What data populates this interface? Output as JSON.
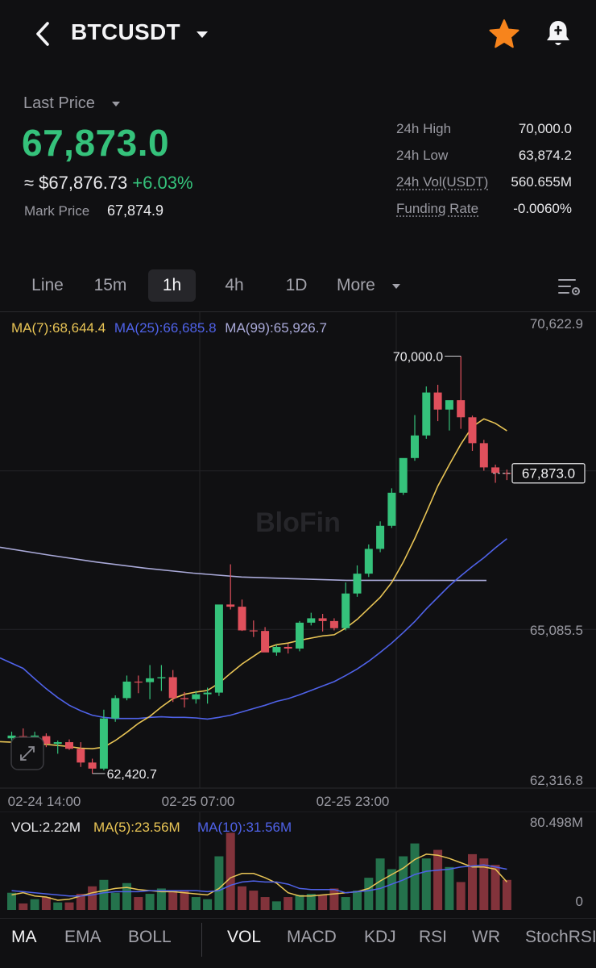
{
  "header": {
    "symbol": "BTCUSDT",
    "icons": {
      "back": "chevron-left-icon",
      "dropdown": "caret-down-icon",
      "favorite": "star-icon",
      "alert": "bell-icon"
    },
    "favorite_color": "#f7841c"
  },
  "price": {
    "last_price_label": "Last Price",
    "last_price": "67,873.0",
    "usd_equiv": "≈ $67,876.73",
    "change_pct": "+6.03%",
    "mark_label": "Mark Price",
    "mark_value": "67,874.9",
    "stats": [
      {
        "label": "24h High",
        "value": "70,000.0"
      },
      {
        "label": "24h Low",
        "value": "63,874.2"
      },
      {
        "label": "24h Vol(USDT)",
        "value": "560.655M"
      },
      {
        "label": "Funding Rate",
        "value": "-0.0060%"
      }
    ],
    "up_color": "#35c27b",
    "down_color": "#e0505c"
  },
  "timeframes": {
    "tabs": [
      "Line",
      "15m",
      "1h",
      "4h",
      "1D",
      "More"
    ],
    "active": "1h"
  },
  "chart_data": {
    "type": "candlestick",
    "watermark": "BloFin",
    "legend": {
      "ma7": "MA(7):68,644.4",
      "ma25": "MA(25):66,685.8",
      "ma99": "MA(99):65,926.7"
    },
    "y_ticks": [
      "70,622.9",
      "65,085.5",
      "62,316.8"
    ],
    "x_ticks": [
      "02-24 14:00",
      "02-25 07:00",
      "02-25 23:00"
    ],
    "high_marker": "70,000.0",
    "low_marker": "62,420.7",
    "current_price_tag": "67,873.0",
    "ylim": [
      62316.8,
      70622.9
    ],
    "candles": [
      [
        63060,
        63180,
        62900,
        63110
      ],
      [
        63100,
        63240,
        62980,
        62990
      ],
      [
        62980,
        63180,
        62820,
        63110
      ],
      [
        63100,
        63150,
        62900,
        62960
      ],
      [
        62960,
        63020,
        62780,
        62990
      ],
      [
        62990,
        63040,
        62850,
        62870
      ],
      [
        62870,
        62990,
        62540,
        62620
      ],
      [
        62620,
        62690,
        62420.7,
        62510
      ],
      [
        62510,
        63580,
        62480,
        63420
      ],
      [
        63420,
        63840,
        63360,
        63790
      ],
      [
        63790,
        64200,
        63750,
        64090
      ],
      [
        64090,
        64200,
        63880,
        64080
      ],
      [
        64080,
        64390,
        63770,
        64150
      ],
      [
        64150,
        64390,
        63920,
        64170
      ],
      [
        64170,
        64300,
        63720,
        63790
      ],
      [
        63790,
        63900,
        63620,
        63770
      ],
      [
        63770,
        63920,
        63690,
        63860
      ],
      [
        63860,
        63980,
        63690,
        63890
      ],
      [
        63890,
        64990,
        63830,
        65490
      ],
      [
        65490,
        66220,
        65400,
        65450
      ],
      [
        65450,
        65580,
        65010,
        65020
      ],
      [
        65020,
        65200,
        64900,
        65010
      ],
      [
        65010,
        65080,
        64800,
        64620
      ],
      [
        64620,
        64760,
        64560,
        64720
      ],
      [
        64720,
        64780,
        64600,
        64690
      ],
      [
        64690,
        65190,
        64640,
        65160
      ],
      [
        65160,
        65340,
        65110,
        65240
      ],
      [
        65240,
        65320,
        65000,
        65190
      ],
      [
        65190,
        65240,
        65020,
        65060
      ],
      [
        65060,
        65890,
        65020,
        65690
      ],
      [
        65690,
        66200,
        65630,
        66050
      ],
      [
        66050,
        66580,
        65990,
        66500
      ],
      [
        66500,
        67000,
        66440,
        66920
      ],
      [
        66920,
        67600,
        66880,
        67520
      ],
      [
        67520,
        68040,
        67480,
        68150
      ],
      [
        68150,
        68930,
        68100,
        68560
      ],
      [
        68560,
        69450,
        68500,
        69340
      ],
      [
        69340,
        69480,
        68820,
        69030
      ],
      [
        69030,
        69180,
        68650,
        69200
      ],
      [
        69200,
        70000,
        68680,
        68890
      ],
      [
        68890,
        68920,
        68280,
        68420
      ],
      [
        68420,
        68480,
        67920,
        67980
      ],
      [
        67980,
        68030,
        67700,
        67880
      ],
      [
        67880,
        67940,
        67750,
        67873
      ]
    ],
    "ma7_line": [
      63000,
      62980,
      62960,
      62950,
      62930,
      62910,
      62880,
      62870,
      62900,
      63020,
      63170,
      63330,
      63460,
      63630,
      63780,
      63860,
      63900,
      63930,
      64060,
      64240,
      64410,
      64550,
      64690,
      64760,
      64790,
      64840,
      64880,
      64920,
      64940,
      65060,
      65220,
      65420,
      65620,
      65890,
      66260,
      66690,
      67160,
      67640,
      68030,
      68400,
      68720,
      68860,
      68780,
      68644.4
    ],
    "ma25_line": [
      64520,
      64330,
      64140,
      63960,
      63800,
      63660,
      63560,
      63480,
      63440,
      63420,
      63420,
      63420,
      63440,
      63450,
      63440,
      63440,
      63430,
      63410,
      63440,
      63480,
      63540,
      63600,
      63660,
      63730,
      63780,
      63850,
      63930,
      64010,
      64090,
      64200,
      64320,
      64460,
      64620,
      64790,
      64980,
      65180,
      65410,
      65620,
      65830,
      66010,
      66180,
      66340,
      66520,
      66685.8
    ],
    "ma99_line": [
      66530,
      66420,
      66310,
      66200,
      66080,
      65990,
      65930,
      65926.7
    ],
    "volume": {
      "legend": {
        "vol": "VOL:2.22M",
        "ma5": "MA(5):23.56M",
        "ma10": "MA(10):31.56M"
      },
      "y_ticks": [
        "80.498M",
        "0"
      ],
      "ymax": 80.498,
      "bars": [
        16,
        6,
        10,
        12,
        7,
        7,
        15,
        22,
        28,
        16,
        25,
        12,
        15,
        20,
        18,
        18,
        12,
        10,
        50,
        72,
        22,
        18,
        12,
        8,
        12,
        14,
        15,
        14,
        20,
        12,
        18,
        30,
        48,
        38,
        50,
        62,
        48,
        56,
        40,
        26,
        52,
        48,
        42,
        28
      ],
      "ma5": [
        14,
        16,
        13,
        12,
        9,
        10,
        13,
        16,
        18,
        20,
        21,
        19,
        18,
        17,
        17,
        16,
        15,
        14,
        20,
        30,
        34,
        34,
        30,
        25,
        16,
        13,
        13,
        14,
        15,
        16,
        17,
        20,
        27,
        33,
        39,
        47,
        52,
        51,
        48,
        44,
        40,
        40,
        38,
        26
      ],
      "ma10": [
        18,
        17,
        16,
        15,
        14,
        13,
        13,
        14,
        16,
        17,
        17,
        17,
        18,
        18,
        18,
        18,
        18,
        17,
        18,
        23,
        26,
        27,
        26,
        26,
        24,
        20,
        19,
        19,
        19,
        16,
        17,
        18,
        20,
        24,
        28,
        33,
        36,
        37,
        38,
        40,
        41,
        42,
        40,
        38
      ]
    }
  },
  "indicators": {
    "main": [
      "MA",
      "EMA",
      "BOLL"
    ],
    "sub": [
      "VOL",
      "MACD",
      "KDJ",
      "RSI",
      "WR",
      "StochRSI"
    ],
    "active_main": "MA",
    "active_sub": "VOL"
  },
  "colors": {
    "ma7": "#e8c455",
    "ma25": "#4f62e8",
    "ma99": "#a9a9d8"
  }
}
